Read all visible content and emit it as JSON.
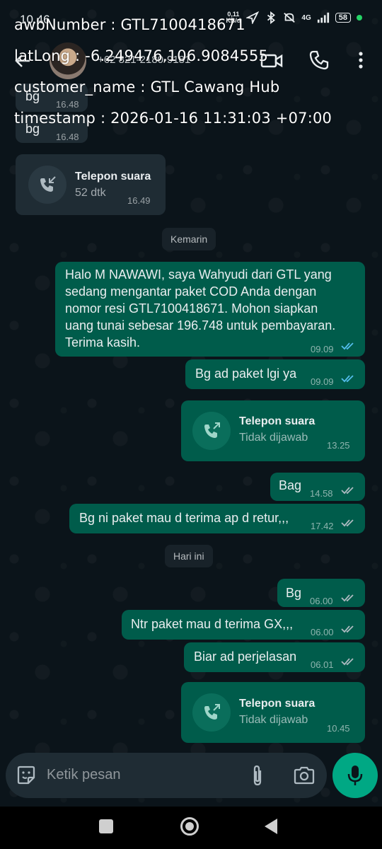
{
  "status_bar": {
    "time": "10.46",
    "net_speed": "0,11",
    "net_unit": "KB/d",
    "network": "4G",
    "battery": "58"
  },
  "header": {
    "contact": "+62 821-2180-9181"
  },
  "overlay": {
    "awb": "awbNumber : GTL7100418671",
    "latlong": "latLong : -6.249476,106.9084555",
    "customer": "customer_name : GTL Cawang Hub",
    "timestamp": "timestamp : 2026-01-16 11:31:03 +07:00"
  },
  "messages": {
    "m1": {
      "text": "bg",
      "time": "16.48"
    },
    "m2": {
      "text": "bg",
      "time": "16.48"
    },
    "call1": {
      "title": "Telepon suara",
      "sub": "52 dtk",
      "time": "16.49"
    },
    "day1": "Kemarin",
    "m3": {
      "text": "Halo M NAWAWI, saya Wahyudi dari GTL yang sedang mengantar paket COD Anda dengan nomor resi GTL7100418671. Mohon siapkan uang tunai sebesar 196.748 untuk pembayaran. Terima kasih.",
      "time": "09.09"
    },
    "m4": {
      "text": "Bg ad paket lgi ya",
      "time": "09.09"
    },
    "call2": {
      "title": "Telepon suara",
      "sub": "Tidak dijawab",
      "time": "13.25"
    },
    "m5": {
      "text": "Bag",
      "time": "14.58"
    },
    "m6": {
      "text": "Bg ni paket mau d terima ap d retur,,,",
      "time": "17.42"
    },
    "day2": "Hari ini",
    "m7": {
      "text": "Bg",
      "time": "06.00"
    },
    "m8": {
      "text": "Ntr paket mau d terima GX,,,",
      "time": "06.00"
    },
    "m9": {
      "text": "Biar ad perjelasan",
      "time": "06.01"
    },
    "call3": {
      "title": "Telepon suara",
      "sub": "Tidak dijawab",
      "time": "10.45"
    }
  },
  "input": {
    "placeholder": "Ketik pesan"
  },
  "colors": {
    "background": "#0b141a",
    "incoming_bubble": "#1f2c34",
    "outgoing_bubble": "#005c4b",
    "read_ticks": "#53bdeb",
    "mic_button": "#00a884"
  }
}
